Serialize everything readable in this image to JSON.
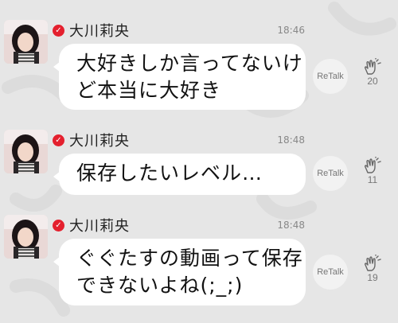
{
  "messages": [
    {
      "name": "大川莉央",
      "time": "18:46",
      "lines": [
        "大好きしか言ってないけ",
        "ど本当に大好き"
      ],
      "retalk_label": "ReTalk",
      "clap_count": "20"
    },
    {
      "name": "大川莉央",
      "time": "18:48",
      "lines": [
        "保存したいレベル…"
      ],
      "retalk_label": "ReTalk",
      "clap_count": "11"
    },
    {
      "name": "大川莉央",
      "time": "18:48",
      "lines": [
        "ぐぐたすの動画って保存",
        "できないよね(;_;)"
      ],
      "retalk_label": "ReTalk",
      "clap_count": "19"
    }
  ],
  "icons": {
    "verified": "verified-check-icon",
    "clap": "clap-hands-icon"
  },
  "colors": {
    "background": "#e6e6e6",
    "bubble": "#ffffff",
    "verified_badge": "#e4202e"
  }
}
